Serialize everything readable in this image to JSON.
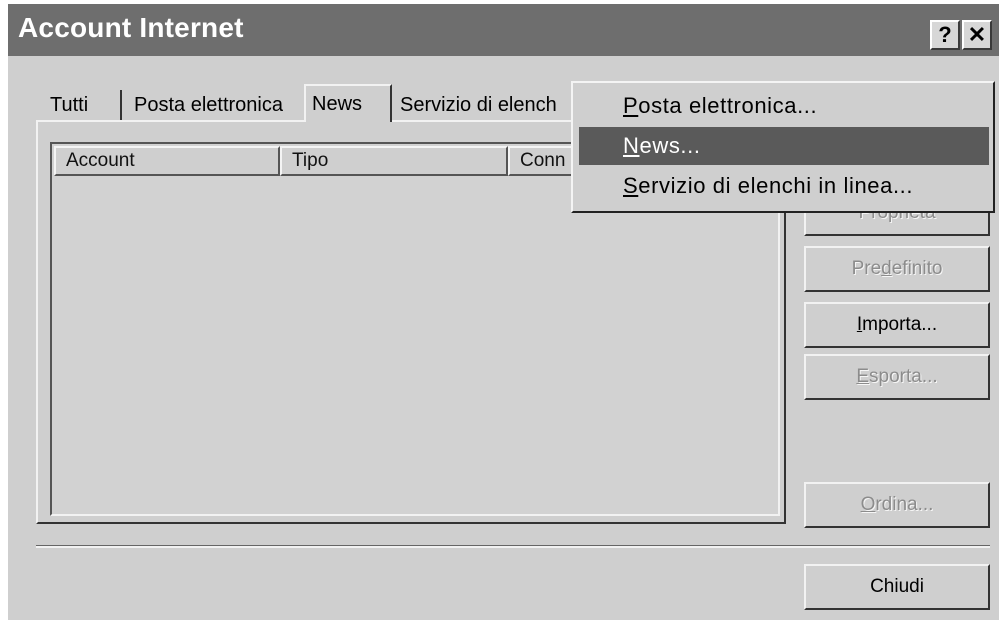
{
  "window": {
    "title": "Account Internet",
    "help_label": "?",
    "close_label": "✕"
  },
  "tabs": [
    {
      "label": "Tutti",
      "active": false
    },
    {
      "label": "Posta elettronica",
      "active": false
    },
    {
      "label": "News",
      "active": true
    },
    {
      "label": "Servizio di elench",
      "active": false
    }
  ],
  "list": {
    "columns": [
      "Account",
      "Tipo",
      "Conn"
    ],
    "rows": []
  },
  "buttons": {
    "proprieta": {
      "label": "Proprietà",
      "enabled": false
    },
    "predefinito": {
      "label_pre": "Pre",
      "label_ul": "d",
      "label_post": "efinito",
      "enabled": false
    },
    "importa": {
      "label_pre": "",
      "label_ul": "I",
      "label_post": "mporta...",
      "enabled": true
    },
    "esporta": {
      "label_pre": "",
      "label_ul": "E",
      "label_post": "sporta...",
      "enabled": false
    },
    "ordina": {
      "label_pre": "",
      "label_ul": "O",
      "label_post": "rdina...",
      "enabled": false
    },
    "chiudi": {
      "label": "Chiudi",
      "enabled": true
    }
  },
  "menu": {
    "items": [
      {
        "ul": "P",
        "rest": "osta elettronica...",
        "highlighted": false
      },
      {
        "ul": "N",
        "rest": "ews...",
        "highlighted": true
      },
      {
        "ul": "S",
        "rest": "ervizio di elenchi in linea...",
        "highlighted": false
      }
    ]
  }
}
